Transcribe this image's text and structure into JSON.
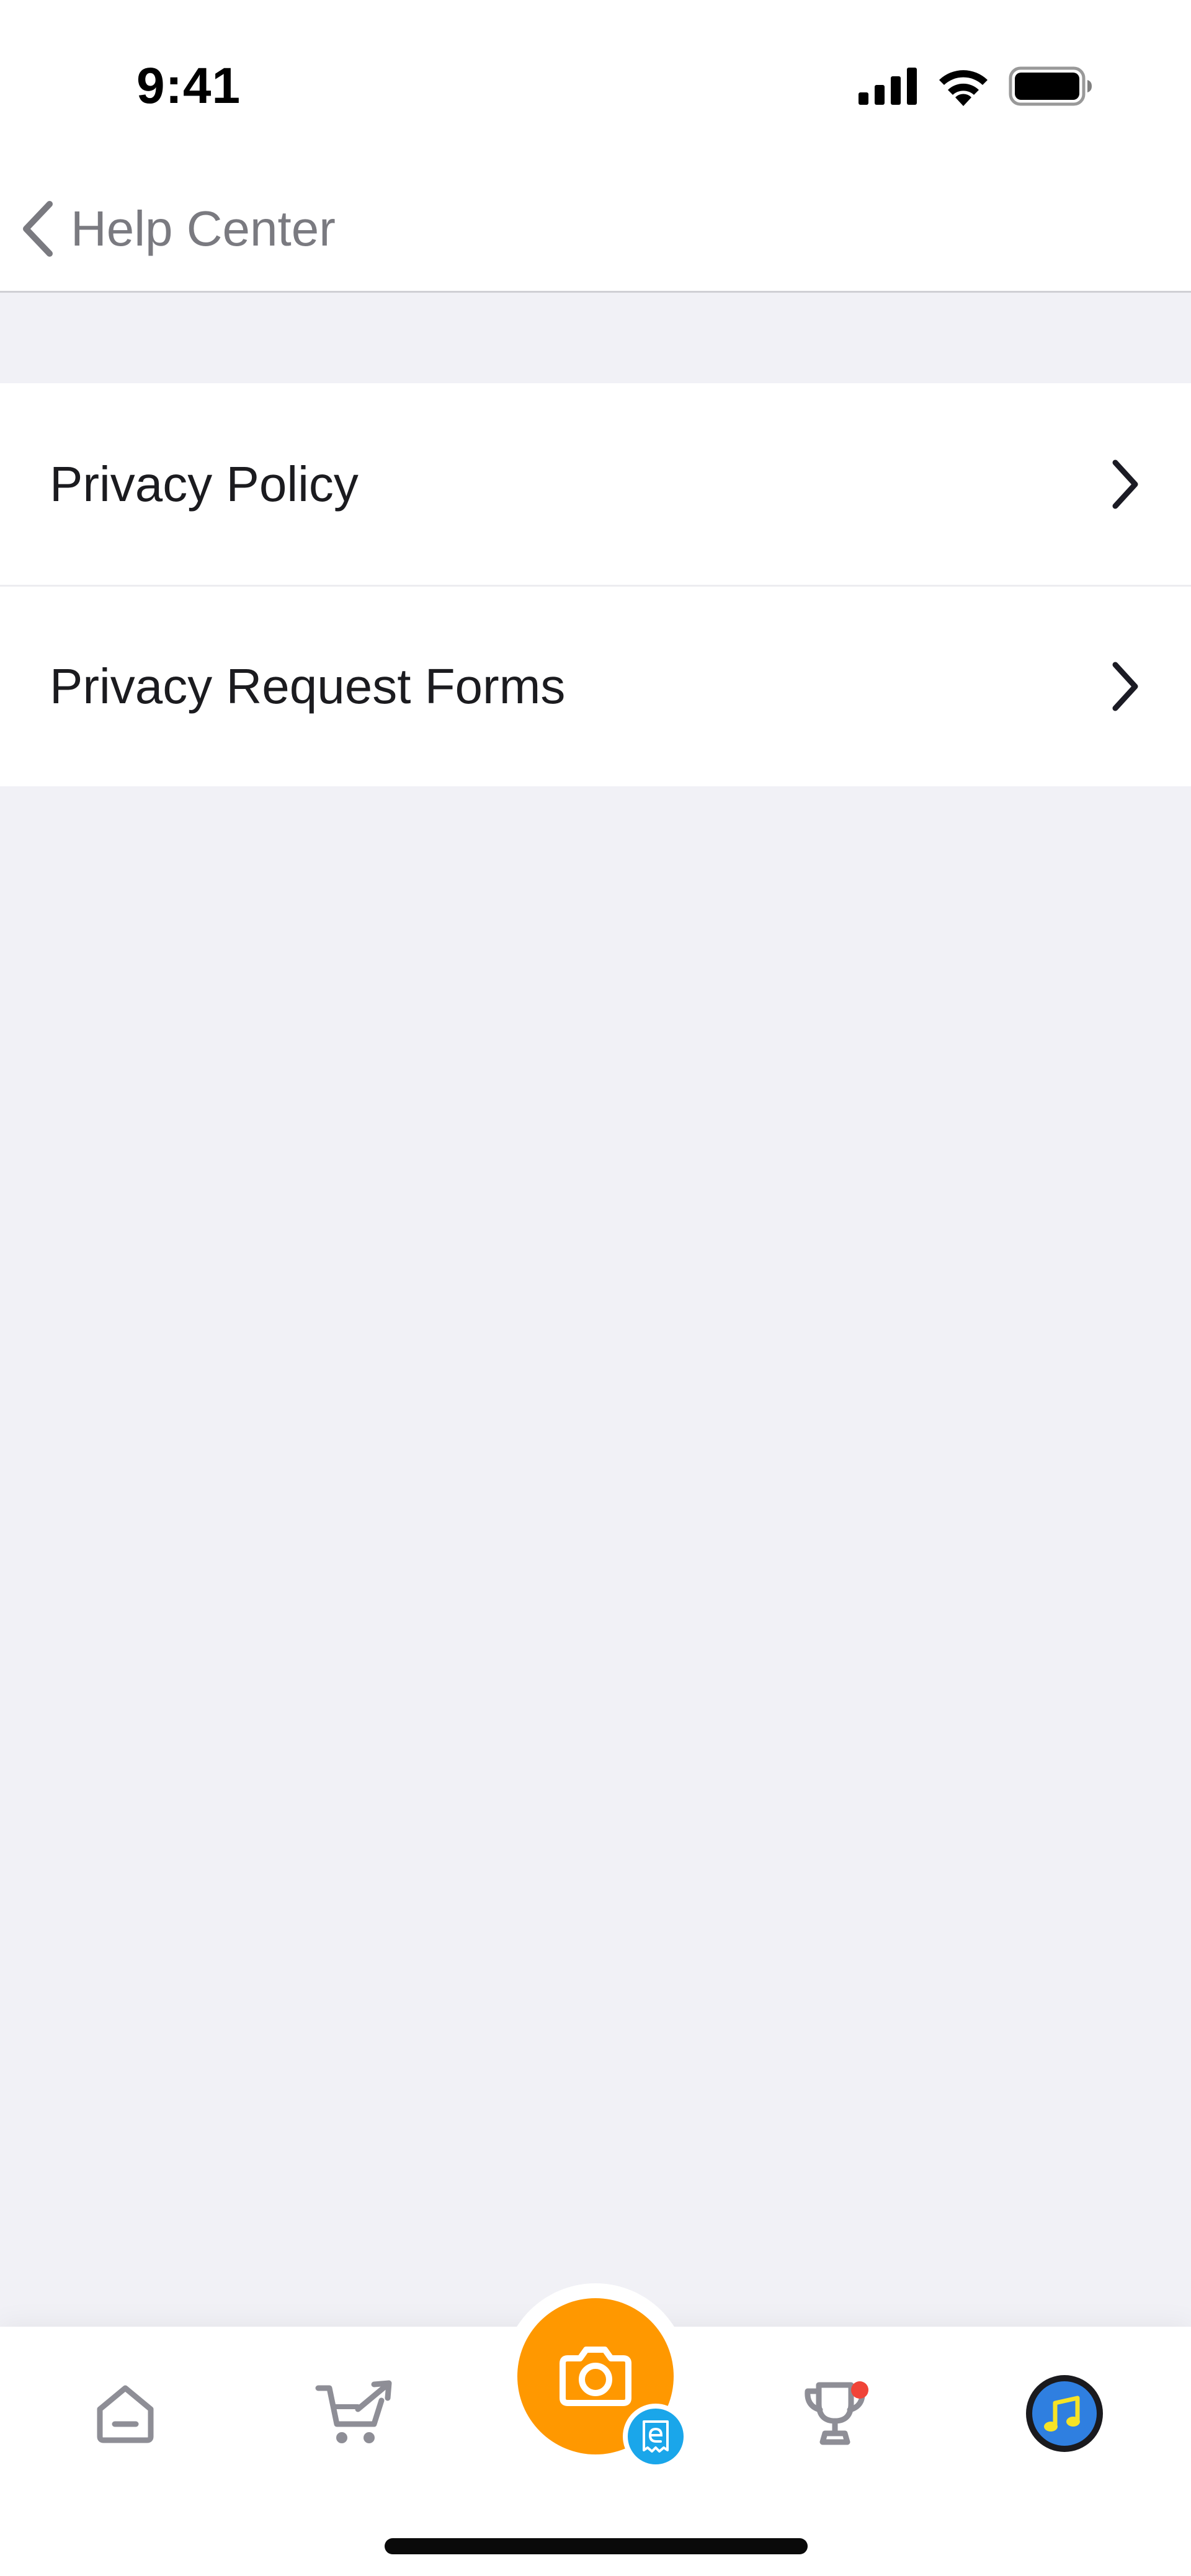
{
  "status_bar": {
    "time": "9:41",
    "icons": [
      "cellular-signal-icon",
      "wifi-icon",
      "battery-icon"
    ]
  },
  "header": {
    "back_label": "Help Center",
    "icon": "chevron-left-icon"
  },
  "list": {
    "items": [
      {
        "label": "Privacy Policy",
        "icon": "chevron-right-icon"
      },
      {
        "label": "Privacy Request Forms",
        "icon": "chevron-right-icon"
      }
    ]
  },
  "tab_bar": {
    "tabs": [
      {
        "icon": "home-icon"
      },
      {
        "icon": "cart-share-icon"
      },
      {
        "icon": "camera-icon",
        "badge_icon": "ereceipt-icon"
      },
      {
        "icon": "trophy-icon",
        "has_notification": true
      },
      {
        "icon": "music-avatar-icon"
      }
    ]
  },
  "colors": {
    "background": "#f1f1f6",
    "accent_orange": "#ff9800",
    "badge_blue": "#1aa6ea",
    "notification_red": "#f04438",
    "icon_gray": "#8e8e96"
  }
}
